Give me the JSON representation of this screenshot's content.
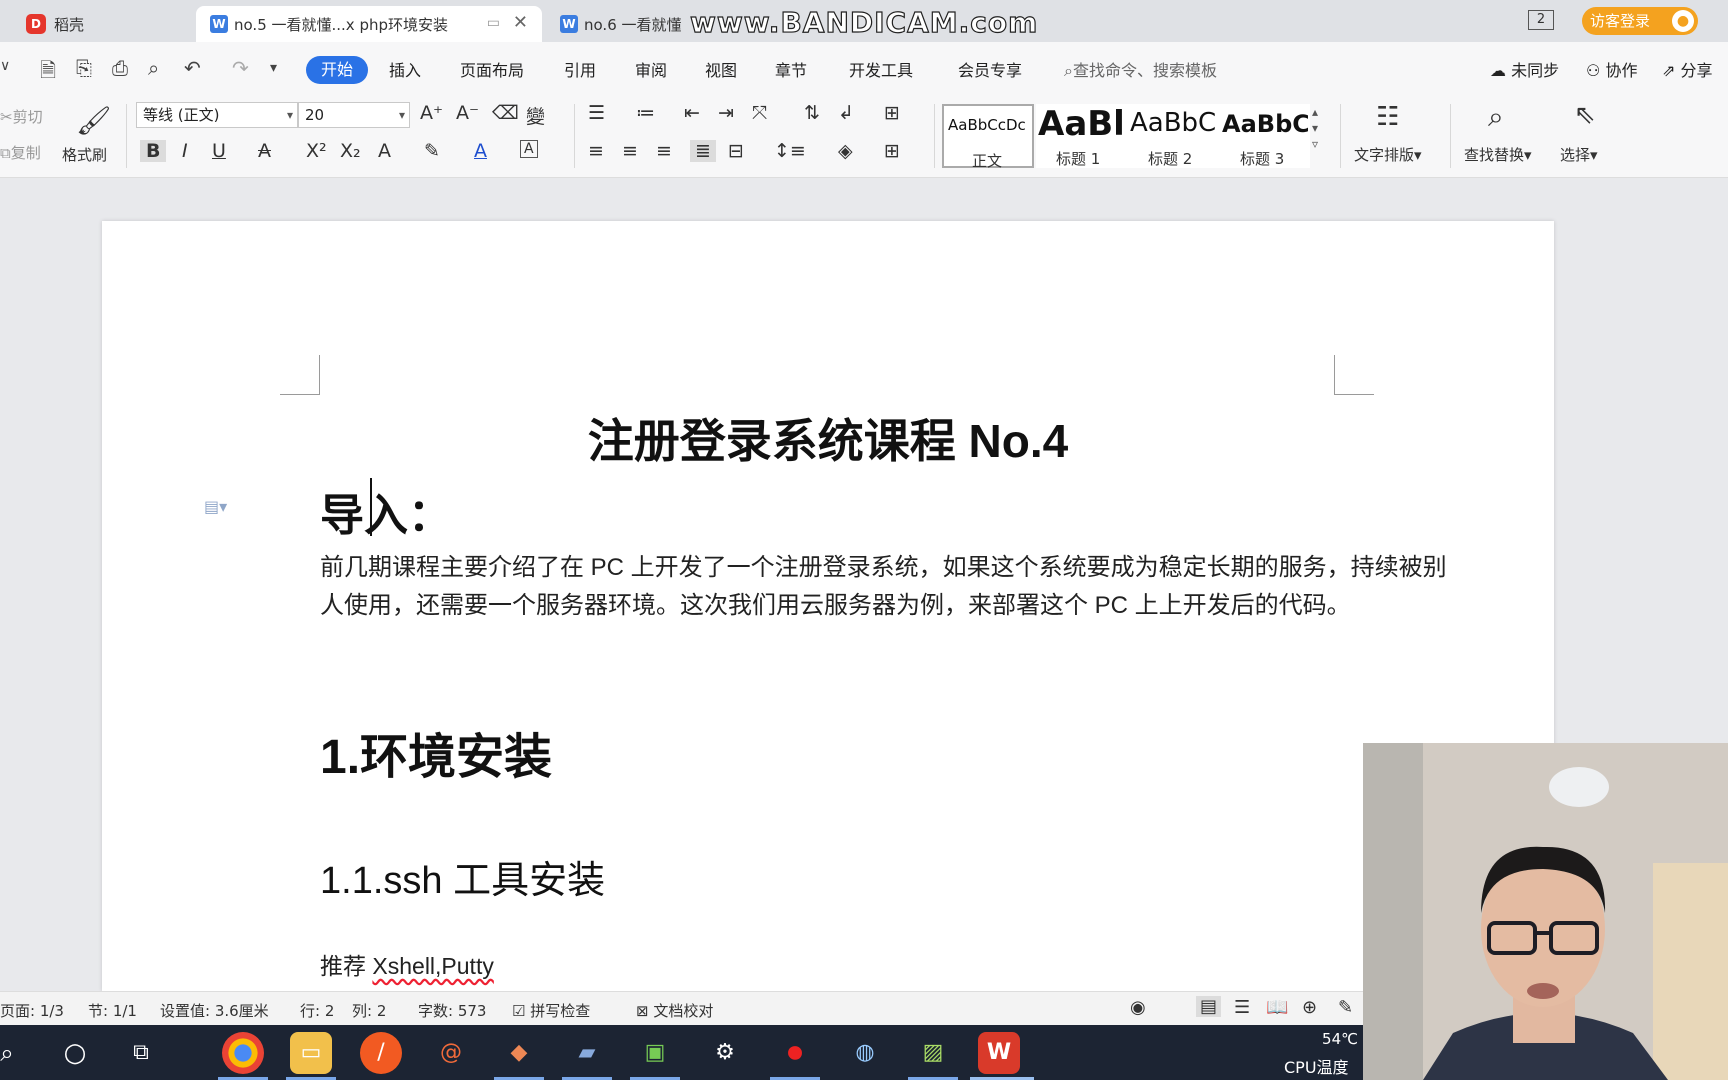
{
  "tabs": [
    {
      "label": "稻壳",
      "icon": "docer-app-icon"
    },
    {
      "label": "no.5 一看就懂...x php环境安装",
      "icon": "wps-doc-icon"
    },
    {
      "label": "no.6 一看就懂",
      "icon": "wps-doc-icon"
    }
  ],
  "watermark": "www.BANDICAM.com",
  "window_count": "2",
  "login_label": "访客登录",
  "menu": {
    "items": [
      "开始",
      "插入",
      "页面布局",
      "引用",
      "审阅",
      "视图",
      "章节",
      "开发工具",
      "会员专享"
    ],
    "search_placeholder": "查找命令、搜索模板",
    "right": [
      "未同步",
      "协作",
      "分享"
    ]
  },
  "ribbon": {
    "cut": "剪切",
    "copy": "复制",
    "format_painter": "格式刷",
    "font_name": "等线 (正文)",
    "font_size": "20",
    "styles": [
      {
        "preview": "AaBbCcDc",
        "name": "正文"
      },
      {
        "preview": "AaBl",
        "name": "标题 1"
      },
      {
        "preview": "AaBbC",
        "name": "标题 2"
      },
      {
        "preview": "AaBbC",
        "name": "标题 3"
      }
    ],
    "text_layout": "文字排版",
    "find_replace": "查找替换",
    "select": "选择"
  },
  "document": {
    "title": "注册登录系统课程  No.4",
    "intro_heading": "导入：",
    "paragraph": "前几期课程主要介绍了在 PC 上开发了一个注册登录系统，如果这个系统要成为稳定长期的服务，持续被别人使用，还需要一个服务器环境。这次我们用云服务器为例，来部署这个 PC 上上开发后的代码。",
    "heading1": "1.环境安装",
    "heading2": "1.1.ssh 工具安装",
    "recommend_prefix": "推荐 ",
    "recommend_tools": "Xshell,Putty"
  },
  "status": {
    "page": "页面: 1/3",
    "section": "节: 1/1",
    "setting": "设置值: 3.6厘米",
    "row": "行: 2",
    "col": "列: 2",
    "wordcount": "字数: 573",
    "spellcheck": "拼写检查",
    "proofread": "文档校对"
  },
  "taskbar": {
    "apps": [
      "chrome-icon",
      "file-explorer-icon",
      "app-orange-icon",
      "snail-app-icon",
      "git-icon",
      "notes-icon",
      "money-app-icon",
      "settings-icon",
      "record-icon",
      "browser-icon",
      "editor-icon",
      "wps-icon"
    ],
    "temperature": "54℃",
    "cpu_label": "CPU温度"
  }
}
